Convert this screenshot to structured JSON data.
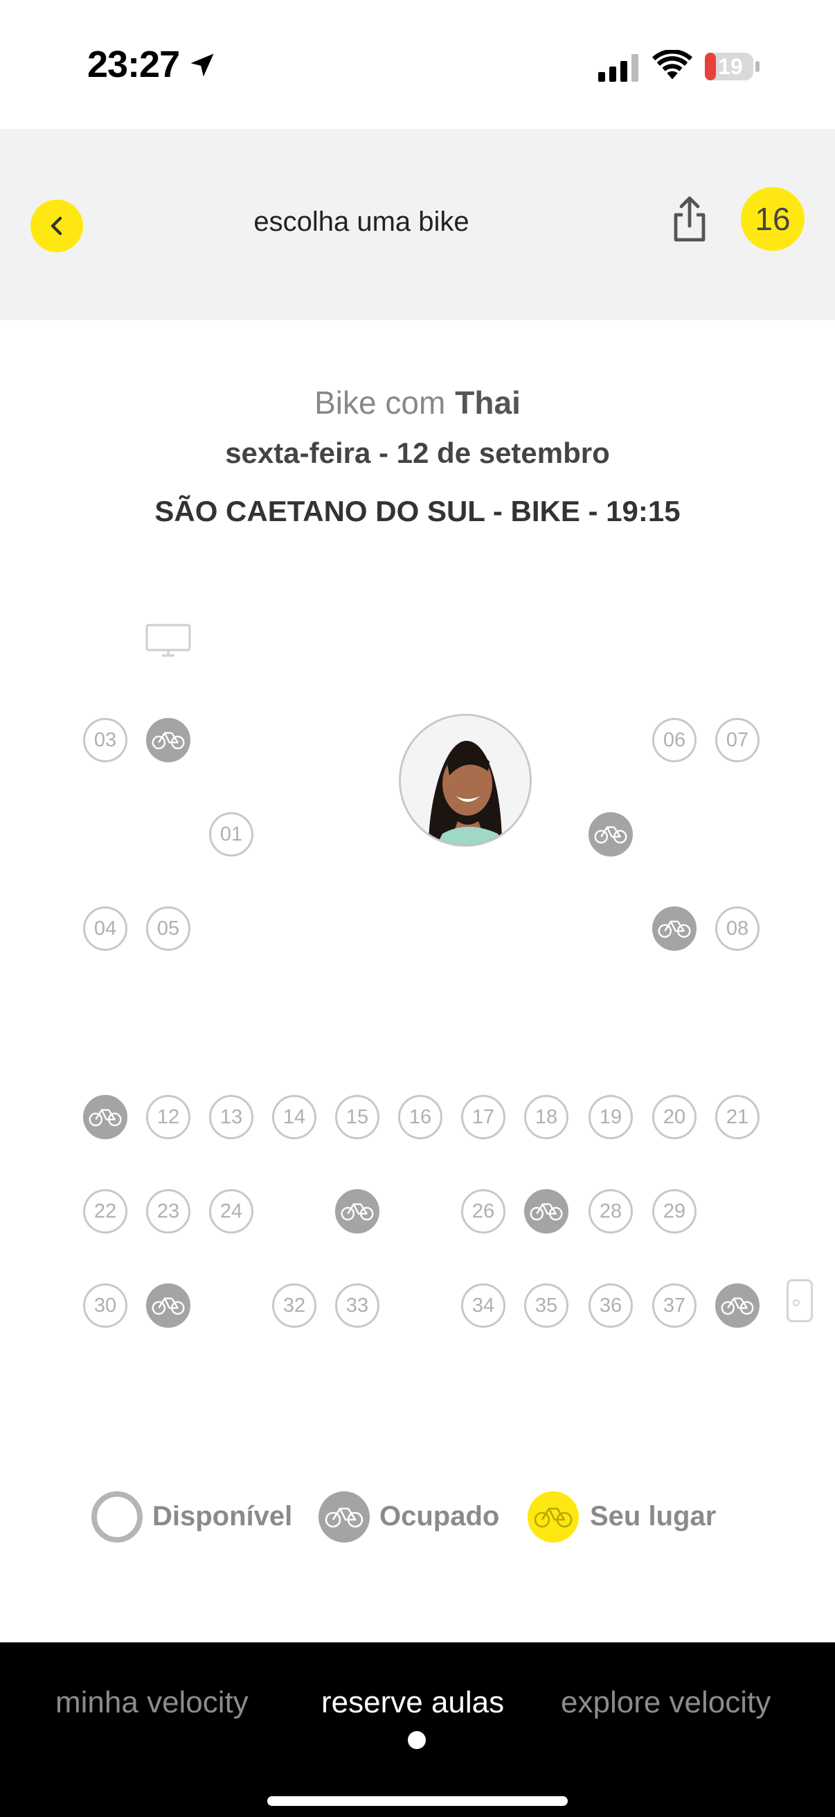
{
  "status_bar": {
    "time": "23:27",
    "battery": "19",
    "icons": [
      "location-arrow-icon",
      "signal-icon",
      "wifi-icon",
      "battery-icon"
    ]
  },
  "header": {
    "title": "escolha uma bike",
    "badge": "16",
    "icons": [
      "back-chevron-icon",
      "share-icon"
    ],
    "accent_color": "#ffe812"
  },
  "class_info": {
    "prefix": "Bike com",
    "instructor": "Thai",
    "date": "sexta-feira - 12 de setembro",
    "location": "SÃO CAETANO DO SUL - BIKE - 19:15"
  },
  "seats": [
    {
      "label": "03",
      "status": "available"
    },
    {
      "label": "",
      "status": "occupied"
    },
    {
      "label": "06",
      "status": "available"
    },
    {
      "label": "07",
      "status": "available"
    },
    {
      "label": "01",
      "status": "available"
    },
    {
      "label": "",
      "status": "occupied"
    },
    {
      "label": "04",
      "status": "available"
    },
    {
      "label": "05",
      "status": "available"
    },
    {
      "label": "",
      "status": "occupied"
    },
    {
      "label": "08",
      "status": "available"
    },
    {
      "label": "",
      "status": "occupied"
    },
    {
      "label": "12",
      "status": "available"
    },
    {
      "label": "13",
      "status": "available"
    },
    {
      "label": "14",
      "status": "available"
    },
    {
      "label": "15",
      "status": "available"
    },
    {
      "label": "16",
      "status": "available"
    },
    {
      "label": "17",
      "status": "available"
    },
    {
      "label": "18",
      "status": "available"
    },
    {
      "label": "19",
      "status": "available"
    },
    {
      "label": "20",
      "status": "available"
    },
    {
      "label": "21",
      "status": "available"
    },
    {
      "label": "22",
      "status": "available"
    },
    {
      "label": "23",
      "status": "available"
    },
    {
      "label": "24",
      "status": "available"
    },
    {
      "label": "",
      "status": "occupied"
    },
    {
      "label": "26",
      "status": "available"
    },
    {
      "label": "",
      "status": "occupied"
    },
    {
      "label": "28",
      "status": "available"
    },
    {
      "label": "29",
      "status": "available"
    },
    {
      "label": "30",
      "status": "available"
    },
    {
      "label": "",
      "status": "occupied"
    },
    {
      "label": "32",
      "status": "available"
    },
    {
      "label": "33",
      "status": "available"
    },
    {
      "label": "34",
      "status": "available"
    },
    {
      "label": "35",
      "status": "available"
    },
    {
      "label": "36",
      "status": "available"
    },
    {
      "label": "37",
      "status": "available"
    },
    {
      "label": "",
      "status": "occupied"
    }
  ],
  "legend": {
    "available": "Disponível",
    "occupied": "Ocupado",
    "mine": "Seu lugar",
    "colors": {
      "available": "#b5b5b5",
      "occupied": "#a4a4a6",
      "mine": "#ffe812"
    }
  },
  "bottom_nav": {
    "items": [
      "minha velocity",
      "reserve aulas",
      "explore velocity"
    ],
    "active": "reserve aulas"
  }
}
